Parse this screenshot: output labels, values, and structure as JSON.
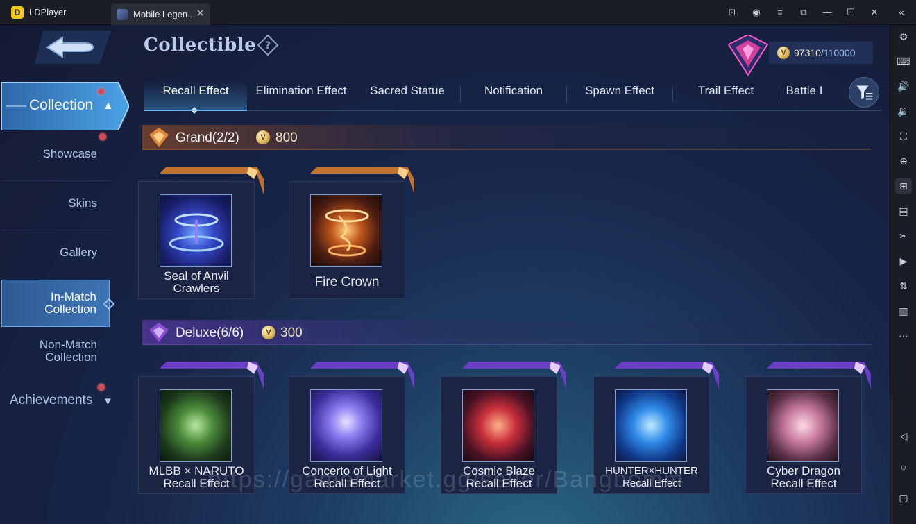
{
  "window": {
    "app_name": "LDPlayer",
    "tab_title": "Mobile Legen...",
    "close_glyph": "✕"
  },
  "header": {
    "title": "Collectible",
    "points_current": "97310",
    "points_max": "/110000"
  },
  "nav": {
    "collection": "Collection",
    "items": [
      "Showcase",
      "Skins",
      "Gallery",
      "In-Match Collection",
      "Non-Match Collection"
    ],
    "achievements": "Achievements",
    "selected": "In-Match Collection"
  },
  "tabs": [
    "Recall Effect",
    "Elimination Effect",
    "Sacred Statue",
    "Notification",
    "Spawn Effect",
    "Trail Effect",
    "Battle I"
  ],
  "active_tab": "Recall Effect",
  "sections": {
    "grand": {
      "label": "Grand(2/2)",
      "price": "800",
      "items": [
        "Seal of Anvil Crawlers",
        "Fire Crown"
      ]
    },
    "deluxe": {
      "label": "Deluxe(6/6)",
      "price": "300",
      "items": [
        "MLBB × NARUTO Recall Effect",
        "Concerto of Light Recall Effect",
        "Cosmic Blaze Recall Effect",
        "HUNTER×HUNTER Recall Effect",
        "Cyber Dragon Recall Effect"
      ]
    }
  },
  "card_names": {
    "g0": "Seal of Anvil",
    "g0b": "Crawlers",
    "g1": "Fire Crown",
    "d0": "MLBB × NARUTO",
    "d1": "Concerto of Light",
    "d2": "Cosmic Blaze",
    "d3": "HUNTER×HUNTER",
    "d4": "Cyber Dragon",
    "suffix": "Recall Effect"
  },
  "watermark": "https://gamemarket.gg/seller/Bangbomm",
  "colors": {
    "accent": "#6fc0ff",
    "grand": "#e0893a",
    "deluxe": "#8b4fd8",
    "badge": "#d54a57"
  },
  "icons": {
    "back": "back-arrow-icon",
    "help": "question-diamond-icon",
    "filter": "filter-icon",
    "coin": "diamond-coin-icon"
  }
}
